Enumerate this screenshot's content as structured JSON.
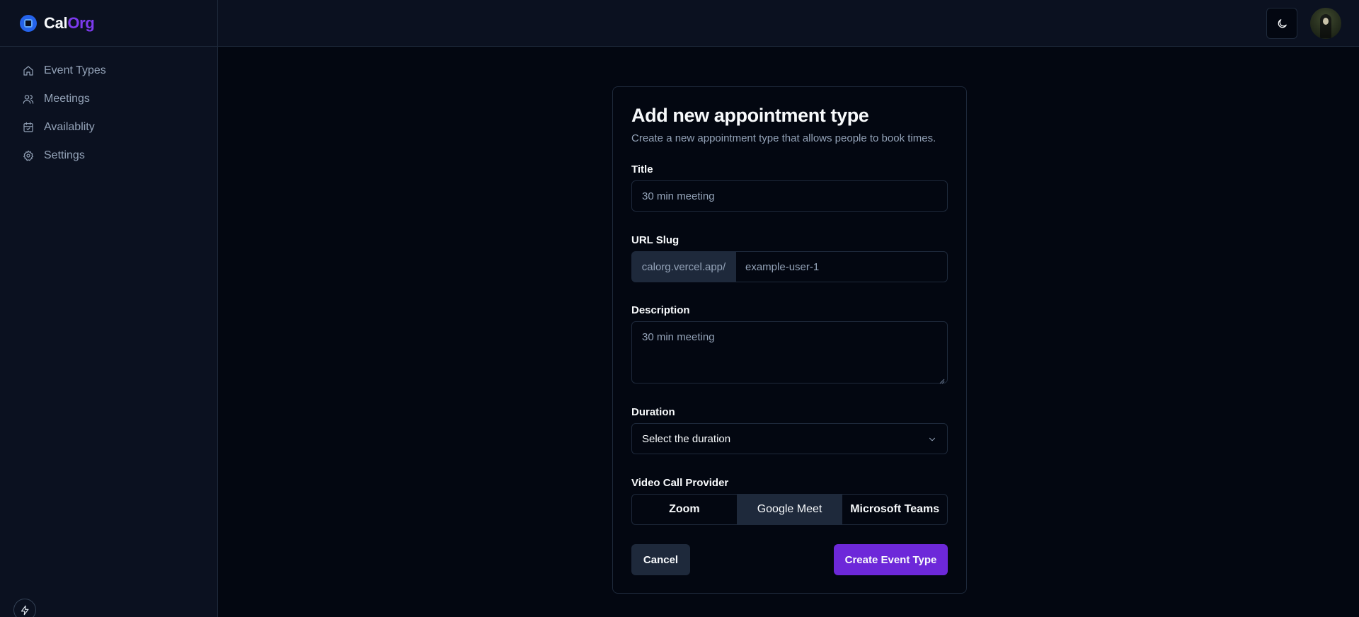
{
  "brand": {
    "part1": "Cal",
    "part2": "Org"
  },
  "sidebar": {
    "items": [
      {
        "label": "Event Types",
        "icon": "home-icon"
      },
      {
        "label": "Meetings",
        "icon": "users-icon"
      },
      {
        "label": "Availablity",
        "icon": "calendar-check-icon"
      },
      {
        "label": "Settings",
        "icon": "gear-icon"
      }
    ]
  },
  "header": {
    "theme_toggle_icon": "moon-icon",
    "avatar": "user-avatar"
  },
  "form": {
    "title": "Add new appointment type",
    "subtitle": "Create a new appointment type that allows people to book times.",
    "title_label": "Title",
    "title_placeholder": "30 min meeting",
    "slug_label": "URL Slug",
    "slug_prefix": "calorg.vercel.app/",
    "slug_placeholder": "example-user-1",
    "description_label": "Description",
    "description_placeholder": "30 min meeting",
    "duration_label": "Duration",
    "duration_value": "Select the duration",
    "provider_label": "Video Call Provider",
    "providers": [
      "Zoom",
      "Google Meet",
      "Microsoft Teams"
    ],
    "selected_provider": "Google Meet",
    "cancel_label": "Cancel",
    "submit_label": "Create Event Type"
  },
  "colors": {
    "accent": "#6d28d9",
    "background": "#030711",
    "sidebar": "#0b1120",
    "border": "#1e293b"
  }
}
